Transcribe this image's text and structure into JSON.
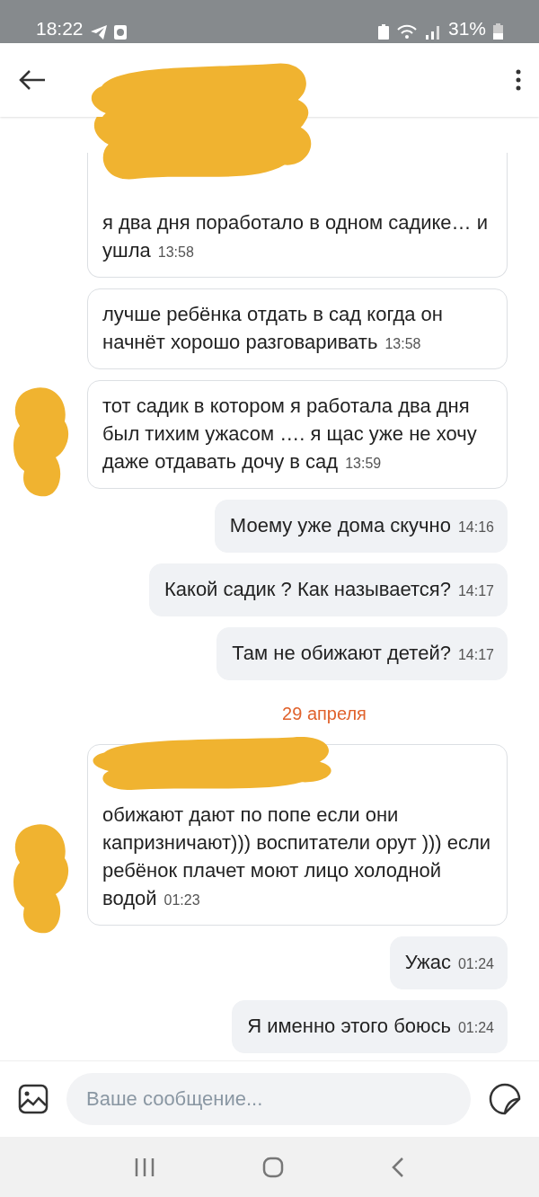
{
  "status_bar": {
    "time": "18:22",
    "battery": "31%"
  },
  "header": {
    "title_hidden": true
  },
  "feed": [
    {
      "kind": "incoming",
      "text": "я два дня поработало в одном садике… и ушла",
      "time": "13:58",
      "name_hidden": true,
      "cut_top": true,
      "avatar_hidden": false
    },
    {
      "kind": "incoming",
      "text": "лучше ребёнка отдать в сад когда он начнёт хорошо разговаривать",
      "time": "13:58",
      "name_hidden": false,
      "cut_top": false,
      "avatar_hidden": false
    },
    {
      "kind": "incoming",
      "text": "тот садик в котором я работала два дня был тихим ужасом  …. я щас уже не хочу даже отдавать дочу в сад",
      "time": "13:59",
      "name_hidden": false,
      "cut_top": false,
      "avatar_hidden": true
    },
    {
      "kind": "outgoing",
      "text": "Моему уже дома скучно",
      "time": "14:16"
    },
    {
      "kind": "outgoing",
      "text": "Какой садик ? Как называется?",
      "time": "14:17"
    },
    {
      "kind": "outgoing",
      "text": "Там не обижают детей?",
      "time": "14:17"
    },
    {
      "kind": "date",
      "text": "29 апреля"
    },
    {
      "kind": "incoming",
      "text": "обижают дают по попе если они капризничают))) воспитатели орут ))) если ребёнок плачет моют лицо холодной водой",
      "time": "01:23",
      "name_hidden": true,
      "cut_top": false,
      "avatar_hidden": true
    },
    {
      "kind": "outgoing",
      "text": "Ужас",
      "time": "01:24"
    },
    {
      "kind": "outgoing",
      "text": "Я именно этого боюсь",
      "time": "01:24"
    }
  ],
  "composer": {
    "placeholder": "Ваше сообщение..."
  }
}
